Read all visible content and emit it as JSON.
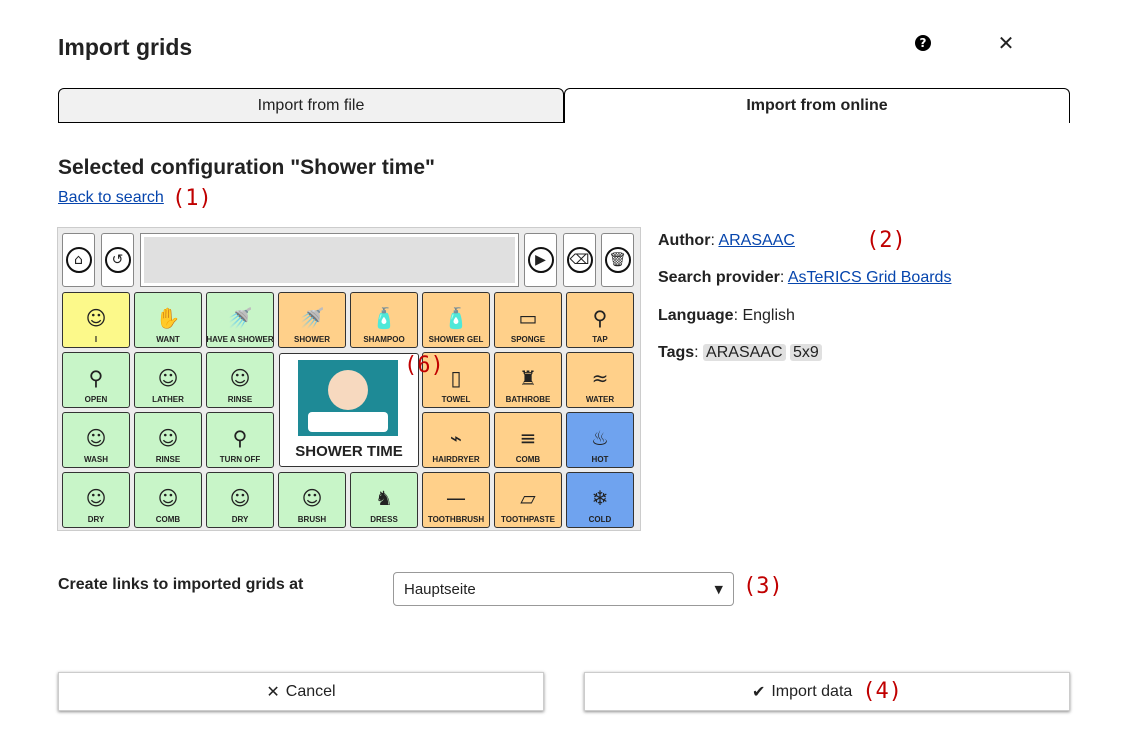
{
  "dialog": {
    "title": "Import grids",
    "tabs": [
      {
        "label": "Import from file",
        "active": false
      },
      {
        "label": "Import from online",
        "active": true
      }
    ]
  },
  "config": {
    "heading": "Selected configuration \"Shower time\"",
    "back_link": "Back to search",
    "author_label": "Author",
    "author_value": "ARASAAC",
    "provider_label": "Search provider",
    "provider_value": "AsTeRICS Grid Boards",
    "language_label": "Language",
    "language_value": "English",
    "tags_label": "Tags",
    "tags": [
      "ARASAAC",
      "5x9"
    ]
  },
  "preview": {
    "big_cell_label": "SHOWER TIME",
    "cells": [
      {
        "label": "I",
        "color": "#fcf98a",
        "icon": "person-icon"
      },
      {
        "label": "WANT",
        "color": "#c8f5c8",
        "icon": "hand-icon"
      },
      {
        "label": "HAVE A SHOWER",
        "color": "#c8f5c8",
        "icon": "shower-icon"
      },
      {
        "label": "SHOWER",
        "color": "#ffd08a",
        "icon": "shower-icon"
      },
      {
        "label": "SHAMPOO",
        "color": "#ffd08a",
        "icon": "bottle-icon"
      },
      {
        "label": "SHOWER GEL",
        "color": "#ffd08a",
        "icon": "bottle-icon"
      },
      {
        "label": "SPONGE",
        "color": "#ffd08a",
        "icon": "sponge-icon"
      },
      {
        "label": "TAP",
        "color": "#ffd08a",
        "icon": "tap-icon"
      },
      {
        "label": "OPEN",
        "color": "#c8f5c8",
        "icon": "tap-icon"
      },
      {
        "label": "LATHER",
        "color": "#c8f5c8",
        "icon": "face-icon"
      },
      {
        "label": "RINSE",
        "color": "#c8f5c8",
        "icon": "face-icon"
      },
      {
        "label": "TOWEL",
        "color": "#ffd08a",
        "icon": "towel-icon"
      },
      {
        "label": "BATHROBE",
        "color": "#ffd08a",
        "icon": "robe-icon"
      },
      {
        "label": "WATER",
        "color": "#ffd08a",
        "icon": "water-icon"
      },
      {
        "label": "WASH",
        "color": "#c8f5c8",
        "icon": "person-icon"
      },
      {
        "label": "RINSE",
        "color": "#c8f5c8",
        "icon": "person-icon"
      },
      {
        "label": "TURN OFF",
        "color": "#c8f5c8",
        "icon": "tap-icon"
      },
      {
        "label": "HAIRDRYER",
        "color": "#ffd08a",
        "icon": "hairdryer-icon"
      },
      {
        "label": "COMB",
        "color": "#ffd08a",
        "icon": "comb-icon"
      },
      {
        "label": "HOT",
        "color": "#6fa3ef",
        "icon": "hot-icon"
      },
      {
        "label": "DRY",
        "color": "#c8f5c8",
        "icon": "person-icon"
      },
      {
        "label": "COMB",
        "color": "#c8f5c8",
        "icon": "face-icon"
      },
      {
        "label": "DRY",
        "color": "#c8f5c8",
        "icon": "person-icon"
      },
      {
        "label": "BRUSH",
        "color": "#c8f5c8",
        "icon": "face-icon"
      },
      {
        "label": "DRESS",
        "color": "#c8f5c8",
        "icon": "shirt-icon"
      },
      {
        "label": "TOOTHBRUSH",
        "color": "#ffd08a",
        "icon": "toothbrush-icon"
      },
      {
        "label": "TOOTHPASTE",
        "color": "#ffd08a",
        "icon": "toothpaste-icon"
      },
      {
        "label": "COLD",
        "color": "#6fa3ef",
        "icon": "snowflake-icon"
      }
    ]
  },
  "import_options": {
    "create_links_label": "Create links to imported grids at",
    "selected_grid": "Hauptseite"
  },
  "footer": {
    "cancel_label": "Cancel",
    "import_label": "Import data"
  },
  "markers": [
    "(1)",
    "(2)",
    "(3)",
    "(4)",
    "(6)"
  ]
}
